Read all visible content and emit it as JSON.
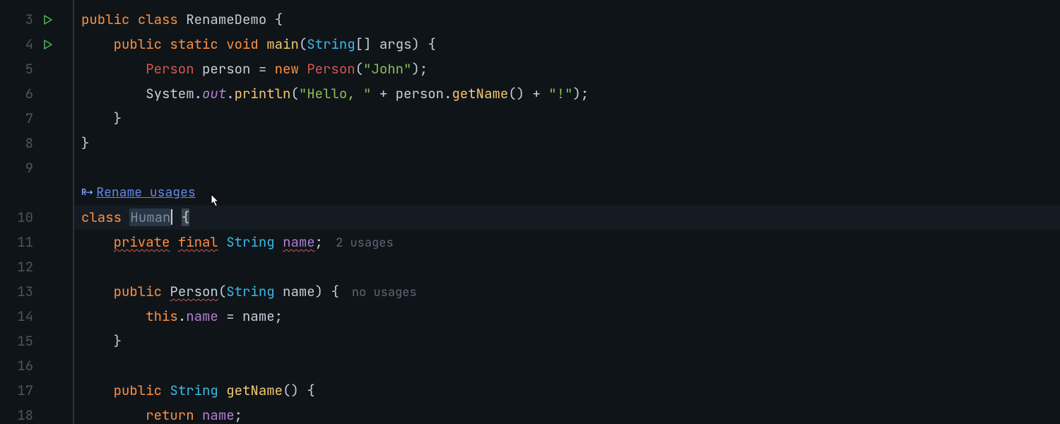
{
  "hint": {
    "icon": "R⇢",
    "label": "Rename usages"
  },
  "usages": {
    "two": "2 usages",
    "none": "no usages"
  },
  "gutter": [
    "3",
    "4",
    "5",
    "6",
    "7",
    "8",
    "9",
    "",
    "10",
    "11",
    "12",
    "13",
    "14",
    "15",
    "16",
    "17",
    "18"
  ],
  "c": {
    "public": "public",
    "class": "class",
    "static": "static",
    "void": "void",
    "new": "new",
    "private": "private",
    "final": "final",
    "return": "return",
    "this": "this",
    "String": "String",
    "args": "args",
    "main": "main",
    "println": "println",
    "getName": "getName",
    "System": "System",
    "out": "out",
    "name": "name",
    "nameFld": "name",
    "RenameDemo": "RenameDemo",
    "Person": "Person",
    "Human": "Human",
    "person": "person",
    "sJohn": "\"John\"",
    "sHello": "\"Hello, \"",
    "sExc": "\"!\"",
    "ob": "{",
    "cb": "}",
    "op": "(",
    "cp": ")",
    "obk": "[",
    "cbk": "]",
    "sc": ";",
    "dot": ".",
    "eq": " = ",
    "plus": " + ",
    "sp": " ",
    "cm": ", "
  }
}
